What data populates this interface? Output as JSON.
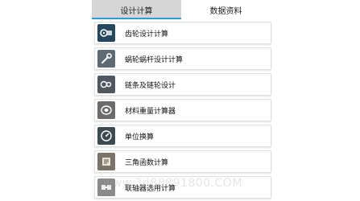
{
  "tabs": [
    {
      "label": "设计计算",
      "active": true
    },
    {
      "label": "数据资料",
      "active": false
    }
  ],
  "menu": [
    {
      "label": "齿轮设计计算",
      "icon": "gear-car-icon"
    },
    {
      "label": "蜗轮蜗杆设计计算",
      "icon": "wrench-icon"
    },
    {
      "label": "链条及链轮设计",
      "icon": "chain-sprocket-icon"
    },
    {
      "label": "材料重量计算器",
      "icon": "material-coil-icon"
    },
    {
      "label": "单位换算",
      "icon": "unit-gauge-icon"
    },
    {
      "label": "三角函数计算",
      "icon": "notebook-icon"
    },
    {
      "label": "联轴器选用计算",
      "icon": "coupling-icon"
    }
  ],
  "watermark": "www.3d88891800.COM",
  "colors": {
    "accent": "#2a9cd8",
    "icon_bg": "#25485e"
  }
}
